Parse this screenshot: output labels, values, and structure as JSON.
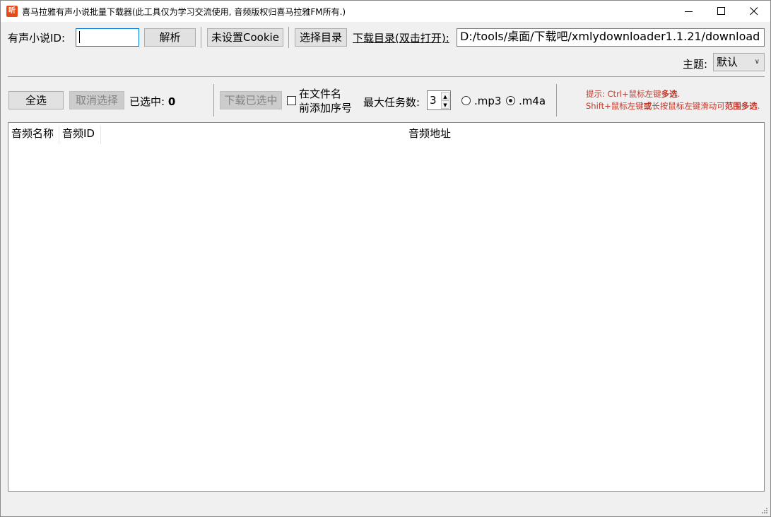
{
  "window": {
    "title": "喜马拉雅有声小说批量下载器(此工具仅为学习交流使用, 音频版权归喜马拉雅FM所有.)",
    "icon_text": "听",
    "controls": [
      "minimize-icon",
      "maximize-icon",
      "close-icon"
    ]
  },
  "top": {
    "id_label": "有声小说ID:",
    "id_value": "",
    "parse_button": "解析",
    "cookie_button": "未设置Cookie",
    "choose_dir_button": "选择目录",
    "download_dir_label": "下载目录(双击打开):",
    "download_dir_value": "D:/tools/桌面/下载吧/xmlydownloader1.1.21/download",
    "theme_label": "主题:",
    "theme_value": "默认"
  },
  "toolbar": {
    "select_all": "全选",
    "deselect": "取消选择",
    "selected_label": "已选中:",
    "selected_count": "0",
    "download_selected": "下载已选中",
    "prefix_line1": "在文件名",
    "prefix_line2": "前添加序号",
    "prefix_checked": false,
    "max_tasks_label": "最大任务数:",
    "max_tasks_value": "3",
    "format_mp3": ".mp3",
    "format_m4a": ".m4a",
    "format_selected": ".m4a",
    "hint_line1_prefix": "提示: Ctrl+鼠标左键",
    "hint_line1_bold": "多选",
    "hint_line1_suffix": ".",
    "hint_line2_prefix": "Shift+鼠标左键",
    "hint_line2_bold1": "或",
    "hint_line2_mid": "长按鼠标左键滑动可",
    "hint_line2_bold2": "范围多选",
    "hint_line2_suffix": ".",
    "hint_color": "#c0392b"
  },
  "table": {
    "columns": [
      "音频名称",
      "音频ID",
      "音频地址"
    ],
    "rows": []
  }
}
